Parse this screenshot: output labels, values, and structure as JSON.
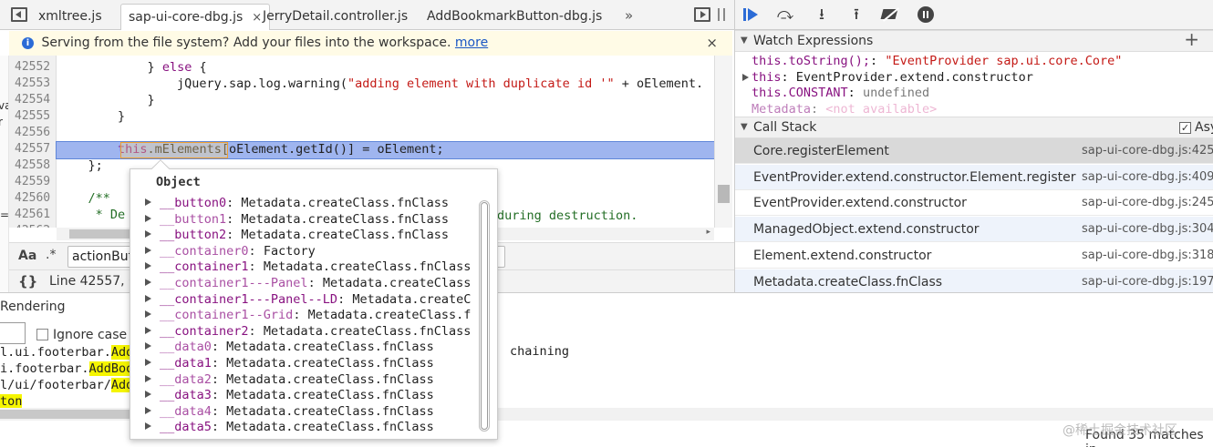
{
  "tabs": {
    "items": [
      {
        "label": "xmltree.js"
      },
      {
        "label": "sap-ui-core-dbg.js",
        "close": "×"
      },
      {
        "label": "JerryDetail.controller.js"
      },
      {
        "label": "AddBookmarkButton-dbg.js"
      }
    ],
    "overflow": "»"
  },
  "infobar": {
    "text": "Serving from the file system? Add your files into the workspace.",
    "link": "more",
    "close": "×"
  },
  "editor": {
    "lines": [
      {
        "num": "42552",
        "indent": "            ",
        "parts": [
          {
            "t": "} ",
            "c": ""
          },
          {
            "t": "else",
            "c": "kw"
          },
          {
            "t": " {",
            "c": ""
          }
        ]
      },
      {
        "num": "42553",
        "indent": "                ",
        "parts": [
          {
            "t": "jQuery.sap.log.warning(",
            "c": ""
          },
          {
            "t": "\"adding element with duplicate id '\"",
            "c": "st"
          },
          {
            "t": " + oElement.",
            "c": ""
          }
        ]
      },
      {
        "num": "42554",
        "indent": "            ",
        "parts": [
          {
            "t": "}",
            "c": ""
          }
        ]
      },
      {
        "num": "42555",
        "indent": "        ",
        "parts": [
          {
            "t": "}",
            "c": ""
          }
        ]
      },
      {
        "num": "42556",
        "indent": "",
        "parts": []
      },
      {
        "num": "42557",
        "indent": "        ",
        "parts": [
          {
            "t": "this",
            "c": "kw"
          },
          {
            "t": ".mElements[oElement.getId()] = oElement;",
            "c": ""
          }
        ]
      },
      {
        "num": "42558",
        "indent": "    ",
        "parts": [
          {
            "t": "};",
            "c": ""
          }
        ]
      },
      {
        "num": "42559",
        "indent": "",
        "parts": []
      },
      {
        "num": "42560",
        "indent": "    ",
        "parts": [
          {
            "t": "/**",
            "c": "cm"
          }
        ]
      },
      {
        "num": "42561",
        "indent": "     ",
        "parts": [
          {
            "t": "* De",
            "c": "cm"
          }
        ]
      },
      {
        "num": "42562",
        "indent": "",
        "parts": []
      }
    ],
    "line_42561_tail": "during destruction."
  },
  "search": {
    "aa": "Aa",
    "regex": ".*",
    "value": "actionBut"
  },
  "status": {
    "braces": "{}",
    "position": "Line 42557, C"
  },
  "right": {
    "toolbar": [
      "resume-icon",
      "step-over-icon",
      "step-into-icon",
      "step-out-icon",
      "deactivate-breakpoints-icon",
      "pause-exceptions-icon"
    ],
    "watch": {
      "title": "Watch Expressions",
      "add": "+",
      "items": [
        {
          "expr": "this.toString();",
          "sep": ": ",
          "value": "\"EventProvider sap.ui.core.Core\"",
          "vcolor": "#c41a16",
          "arrow": false
        },
        {
          "expr": "this",
          "sep": ": ",
          "value": "EventProvider.extend.constructor",
          "vcolor": "#222",
          "arrow": true
        },
        {
          "expr": "this.CONSTANT",
          "sep": ": ",
          "value": "undefined",
          "vcolor": "#777",
          "arrow": false
        },
        {
          "expr": "Metadata",
          "sep": ": ",
          "value": "<not available>",
          "vcolor": "#e07bb0",
          "arrow": false
        }
      ]
    },
    "callstack": {
      "title": "Call Stack",
      "async": "Asy",
      "frames": [
        {
          "fn": "Core.registerElement",
          "loc": "sap-ui-core-dbg.js:425"
        },
        {
          "fn": "EventProvider.extend.constructor.Element.register",
          "loc": "sap-ui-core-dbg.js:409"
        },
        {
          "fn": "EventProvider.extend.constructor",
          "loc": "sap-ui-core-dbg.js:245"
        },
        {
          "fn": "ManagedObject.extend.constructor",
          "loc": "sap-ui-core-dbg.js:304"
        },
        {
          "fn": "Element.extend.constructor",
          "loc": "sap-ui-core-dbg.js:318"
        },
        {
          "fn": "Metadata.createClass.fnClass",
          "loc": "sap-ui-core-dbg.js:197"
        }
      ]
    }
  },
  "bottom": {
    "title": "Rendering",
    "ignore_case": "Ignore case",
    "lines": [
      {
        "pre": "l.ui.footerbar.",
        "hl": "Add",
        "post": ""
      },
      {
        "pre": "i.footerbar.",
        "hl": "AddBoo",
        "post": ""
      },
      {
        "pre": "l/ui/footerbar/",
        "hl": "Add",
        "post": ""
      },
      {
        "pre": "",
        "hl": "ton",
        "post": ""
      }
    ],
    "chaining": "chaining",
    "found": "Found 35 matches in"
  },
  "popup": {
    "title": "Object",
    "rows": [
      {
        "key": "__button0",
        "val": "Metadata.createClass.fnClass",
        "dim": false
      },
      {
        "key": "__button1",
        "val": "Metadata.createClass.fnClass",
        "dim": true
      },
      {
        "key": "__button2",
        "val": "Metadata.createClass.fnClass",
        "dim": false
      },
      {
        "key": "__container0",
        "val": "Factory",
        "dim": true
      },
      {
        "key": "__container1",
        "val": "Metadata.createClass.fnClass",
        "dim": false
      },
      {
        "key": "__container1---Panel",
        "val": "Metadata.createClass",
        "dim": true
      },
      {
        "key": "__container1---Panel--LD",
        "val": "Metadata.createC",
        "dim": false
      },
      {
        "key": "__container1--Grid",
        "val": "Metadata.createClass.f",
        "dim": true
      },
      {
        "key": "__container2",
        "val": "Metadata.createClass.fnClass",
        "dim": false
      },
      {
        "key": "__data0",
        "val": "Metadata.createClass.fnClass",
        "dim": true
      },
      {
        "key": "__data1",
        "val": "Metadata.createClass.fnClass",
        "dim": false
      },
      {
        "key": "__data2",
        "val": "Metadata.createClass.fnClass",
        "dim": true
      },
      {
        "key": "__data3",
        "val": "Metadata.createClass.fnClass",
        "dim": false
      },
      {
        "key": "__data4",
        "val": "Metadata.createClass.fnClass",
        "dim": true
      },
      {
        "key": "__data5",
        "val": "Metadata.createClass.fnClass",
        "dim": false
      }
    ]
  },
  "watermark": "@稀土掘金技术社区"
}
